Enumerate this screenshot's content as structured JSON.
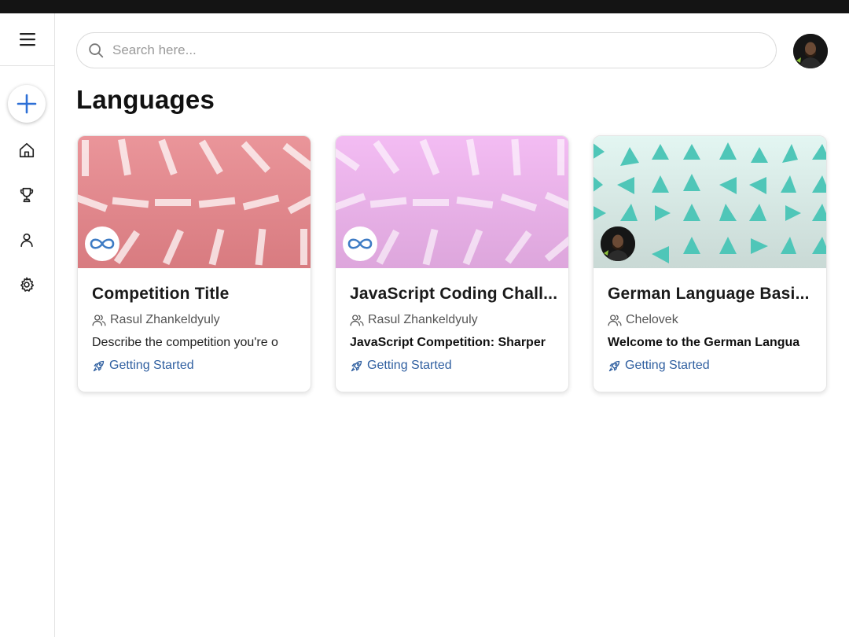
{
  "search": {
    "placeholder": "Search here..."
  },
  "page": {
    "title": "Languages"
  },
  "sidebar": {
    "items": [
      {
        "name": "home",
        "icon": "home-icon"
      },
      {
        "name": "trophy",
        "icon": "trophy-icon"
      },
      {
        "name": "profile",
        "icon": "user-icon"
      },
      {
        "name": "settings",
        "icon": "gear-icon"
      }
    ]
  },
  "colors": {
    "accent": "#2d6fd6",
    "link": "#2f5fa0",
    "card1_banner": "#e0868b",
    "card2_banner": "#eab3ea",
    "card3_banner": "#dff3ef",
    "triangles": "#4fc6b8"
  },
  "cards": [
    {
      "title": "Competition Title",
      "author": "Rasul Zhankeldyuly",
      "description": "Describe the competition you're o",
      "link": "Getting Started",
      "badge_icon": "infinity-icon"
    },
    {
      "title": "JavaScript Coding Chall...",
      "author": "Rasul Zhankeldyuly",
      "description": "JavaScript Competition: Sharper",
      "link": "Getting Started",
      "badge_icon": "infinity-icon"
    },
    {
      "title": "German Language Basi...",
      "author": "Chelovek",
      "description": "Welcome to the German Langua",
      "link": "Getting Started",
      "badge_icon": "user-photo"
    }
  ]
}
